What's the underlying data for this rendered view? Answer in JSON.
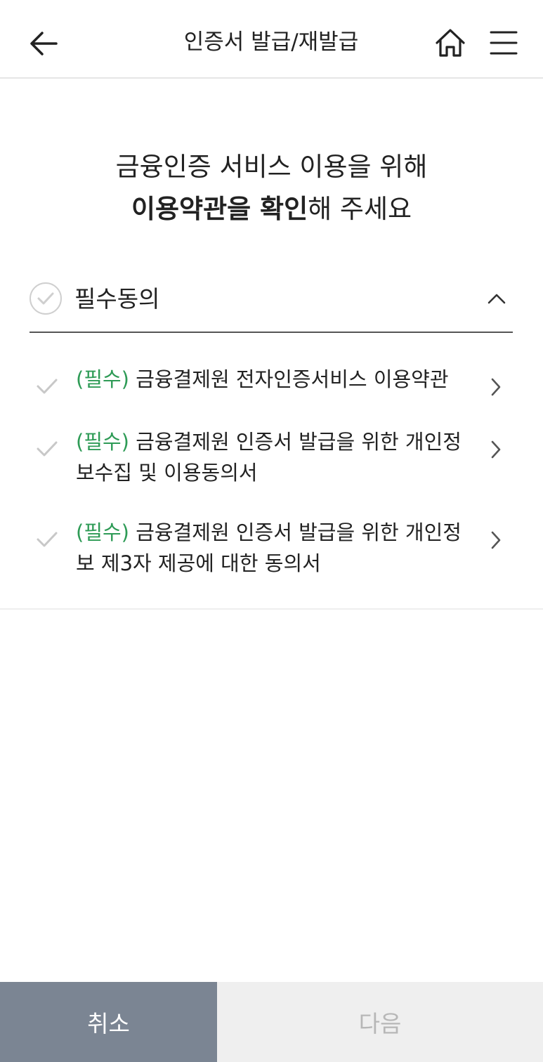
{
  "header": {
    "title": "인증서 발급/재발급",
    "back_icon": "arrow-left-icon",
    "home_icon": "home-icon",
    "menu_icon": "hamburger-menu-icon"
  },
  "headline": {
    "line1": "금융인증 서비스 이용을 위해",
    "line2_bold": "이용약관을 확인",
    "line2_rest": "해 주세요"
  },
  "agree_all": {
    "label": "필수동의",
    "checked": false
  },
  "terms": [
    {
      "tag": "(필수)",
      "text": " 금융결제원 전자인증서비스 이용약관"
    },
    {
      "tag": "(필수)",
      "text": " 금융결제원 인증서 발급을 위한 개인정보수집 및 이용동의서"
    },
    {
      "tag": "(필수)",
      "text": " 금융결제원 인증서 발급을 위한 개인정보 제3자 제공에 대한 동의서"
    }
  ],
  "footer": {
    "cancel_label": "취소",
    "next_label": "다음"
  },
  "colors": {
    "required_tag": "#2e9b56",
    "cancel_bg": "#7b8593",
    "next_bg": "#efefef",
    "next_text": "#b7b7b7"
  }
}
